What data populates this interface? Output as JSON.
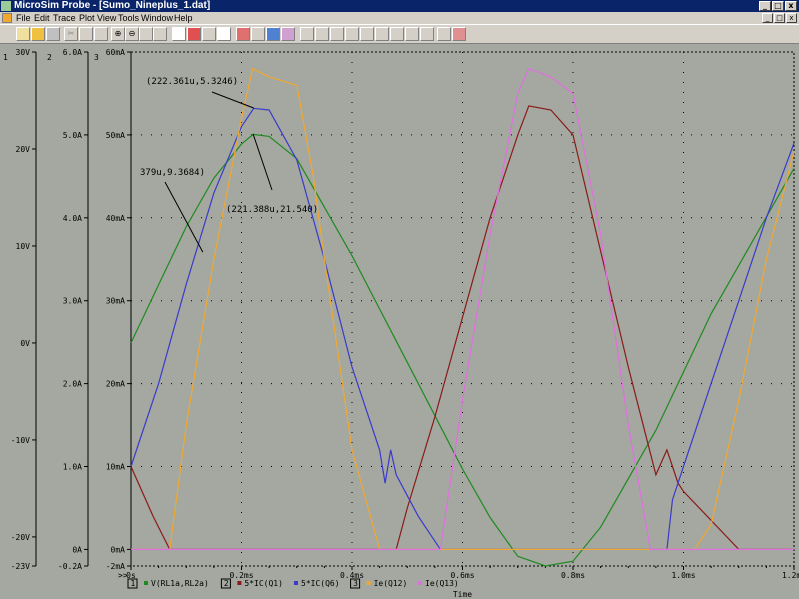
{
  "window": {
    "title": "MicroSim Probe - [Sumo_Nineplus_1.dat]",
    "controls": [
      "_",
      "□",
      "x"
    ],
    "mdi_controls": [
      "_",
      "□",
      "x"
    ]
  },
  "menu": [
    "File",
    "Edit",
    "Trace",
    "Plot",
    "View",
    "Tools",
    "Window",
    "Help"
  ],
  "toolbar": {
    "buttons": [
      "new-icon",
      "open-icon",
      "print-icon",
      "cut-icon",
      "copy-icon",
      "paste-icon",
      "zoom-in-icon",
      "zoom-out-icon",
      "zoom-area-icon",
      "zoom-fit-icon",
      "axis-icon",
      "fourier-icon",
      "performance-icon",
      "add-trace-icon",
      "eval-goal-icon",
      "cursor-icon",
      "mark-icon",
      "label-icon",
      "peak-icon",
      "trough-icon",
      "slope-icon",
      "min-icon",
      "max-icon",
      "point-icon",
      "inflection-icon",
      "next-icon",
      "mark-label-icon",
      "text-icon",
      "line-icon",
      "polyline-icon"
    ]
  },
  "chart_data": {
    "type": "line",
    "xlabel": "Time",
    "x_ticks": [
      "0s",
      "0.2ms",
      "0.4ms",
      "0.6ms",
      "0.8ms",
      "1.0ms",
      "1.2ms"
    ],
    "xlim": [
      0,
      1.2
    ],
    "axes": [
      {
        "id": "1",
        "ticks": [
          "30V",
          "20V",
          "10V",
          "0V",
          "-10V",
          "-20V",
          "-23V"
        ],
        "ylim": [
          -23,
          30
        ]
      },
      {
        "id": "2",
        "ticks": [
          "6.0A",
          "5.0A",
          "4.0A",
          "3.0A",
          "2.0A",
          "1.0A",
          "0A",
          "-0.2A"
        ],
        "ylim": [
          -0.2,
          6.0
        ]
      },
      {
        "id": "3",
        "ticks": [
          "60mA",
          "50mA",
          "40mA",
          "30mA",
          "20mA",
          "10mA",
          "0mA",
          "-2mA"
        ],
        "ylim": [
          -2,
          60
        ]
      }
    ],
    "series": [
      {
        "name": "V(RL1a,RL2a)",
        "axis": "1",
        "color": "#1f8a1f",
        "x": [
          0,
          0.05,
          0.1,
          0.15,
          0.2,
          0.221,
          0.25,
          0.3,
          0.35,
          0.4,
          0.45,
          0.5,
          0.55,
          0.6,
          0.65,
          0.7,
          0.75,
          0.8,
          0.85,
          0.9,
          0.95,
          1.0,
          1.05,
          1.1,
          1.15,
          1.2
        ],
        "y": [
          0,
          6,
          12,
          17,
          20.5,
          21.5,
          21.3,
          19,
          14,
          9,
          3.5,
          -2,
          -7.5,
          -13,
          -18,
          -22,
          -23,
          -22.5,
          -19,
          -14,
          -9,
          -3,
          3,
          8,
          13,
          18
        ]
      },
      {
        "name": "5*IC(Q1)",
        "axis": "2",
        "color": "#8b1a1a",
        "x": [
          0,
          0.04,
          0.07,
          0.48,
          0.5,
          0.55,
          0.6,
          0.65,
          0.7,
          0.72,
          0.76,
          0.8,
          0.85,
          0.9,
          0.95,
          0.97,
          0.98,
          0.99,
          1.0,
          1.1,
          1.2
        ],
        "y": [
          1.0,
          0.4,
          0,
          0,
          0.5,
          1.6,
          2.8,
          4.0,
          5.0,
          5.35,
          5.3,
          5.0,
          3.6,
          2.2,
          0.9,
          1.2,
          1.0,
          0.8,
          0.7,
          0,
          0
        ]
      },
      {
        "name": "5*IC(Q6)",
        "axis": "2",
        "color": "#3a3acc",
        "x": [
          0,
          0.05,
          0.1,
          0.15,
          0.2,
          0.222,
          0.25,
          0.3,
          0.35,
          0.4,
          0.45,
          0.46,
          0.47,
          0.48,
          0.52,
          0.56,
          0.9,
          0.95,
          0.97,
          0.98,
          1.0,
          1.05,
          1.1,
          1.15,
          1.2
        ],
        "y": [
          1.0,
          2.0,
          3.2,
          4.3,
          5.1,
          5.32,
          5.3,
          4.7,
          3.5,
          2.2,
          1.2,
          0.8,
          1.2,
          0.9,
          0.4,
          0,
          0,
          0,
          0,
          0.6,
          1.0,
          2.0,
          3.0,
          4.0,
          4.9
        ]
      },
      {
        "name": "Ie(Q12)",
        "axis": "3",
        "color": "#f0a830",
        "x": [
          0,
          0.07,
          0.1,
          0.15,
          0.2,
          0.22,
          0.25,
          0.3,
          0.33,
          0.35,
          0.4,
          0.45,
          1.02,
          1.05,
          1.1,
          1.15,
          1.2
        ],
        "y": [
          0,
          0,
          15,
          35,
          52,
          58,
          57,
          56,
          45,
          35,
          12,
          0,
          0,
          3,
          18,
          35,
          48
        ]
      },
      {
        "name": "Ie(Q13)",
        "axis": "3",
        "color": "#e070e0",
        "x": [
          0,
          0.56,
          0.6,
          0.65,
          0.7,
          0.72,
          0.76,
          0.8,
          0.85,
          0.9,
          0.94,
          1.2
        ],
        "y": [
          0,
          0,
          18,
          38,
          55,
          58,
          57,
          55,
          38,
          15,
          0,
          0
        ]
      }
    ],
    "annotations": [
      "(222.361u,5.3246)",
      "(221.388u,21.540)",
      "379u,9.3684)"
    ],
    "legend": [
      {
        "axis_box": "1",
        "label": "V(RL1a,RL2a)"
      },
      {
        "axis_box": "2",
        "label": "5*IC(Q1)"
      },
      {
        "label": "5*IC(Q6)"
      },
      {
        "axis_box": "3",
        "label": "Ie(Q12)"
      },
      {
        "label": "Ie(Q13)"
      }
    ],
    "scroll_marker": ">>",
    "grid": "dotted"
  }
}
